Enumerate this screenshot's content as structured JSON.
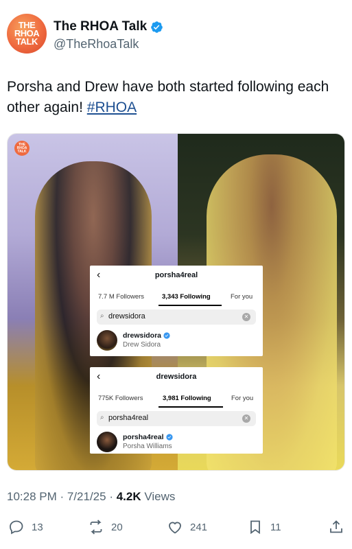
{
  "author": {
    "avatar_text_lines": [
      "THE",
      "RHOA",
      "TALK"
    ],
    "display_name": "The RHOA Talk",
    "handle": "@TheRhoaTalk",
    "verified_icon": "verified-badge-icon"
  },
  "tweet": {
    "text_before": "Porsha and Drew have both started following each other again! ",
    "hashtag": "#RHOA"
  },
  "media": {
    "logo_lines": [
      "THE",
      "RHOA",
      "TALK"
    ],
    "panels": [
      {
        "username": "porsha4real",
        "tabs": [
          "7.7 M Followers",
          "3,343 Following",
          "For you"
        ],
        "active_tab": "3,343 Following",
        "search_value": "drewsidora",
        "result": {
          "username": "drewsidora",
          "full_name": "Drew Sidora"
        }
      },
      {
        "username": "drewsidora",
        "tabs": [
          "775K Followers",
          "3,981 Following",
          "For you"
        ],
        "active_tab": "3,981 Following",
        "search_value": "porsha4real",
        "result": {
          "username": "porsha4real",
          "full_name": "Porsha Williams"
        }
      }
    ]
  },
  "meta": {
    "time": "10:28 PM",
    "date": "7/21/25",
    "views_count": "4.2K",
    "views_label": "Views"
  },
  "actions": {
    "replies": "13",
    "reposts": "20",
    "likes": "241",
    "bookmarks": "11"
  },
  "colors": {
    "hashtag": "#1d4f91",
    "verified": "#1d9bf0",
    "secondary_text": "#536471"
  }
}
